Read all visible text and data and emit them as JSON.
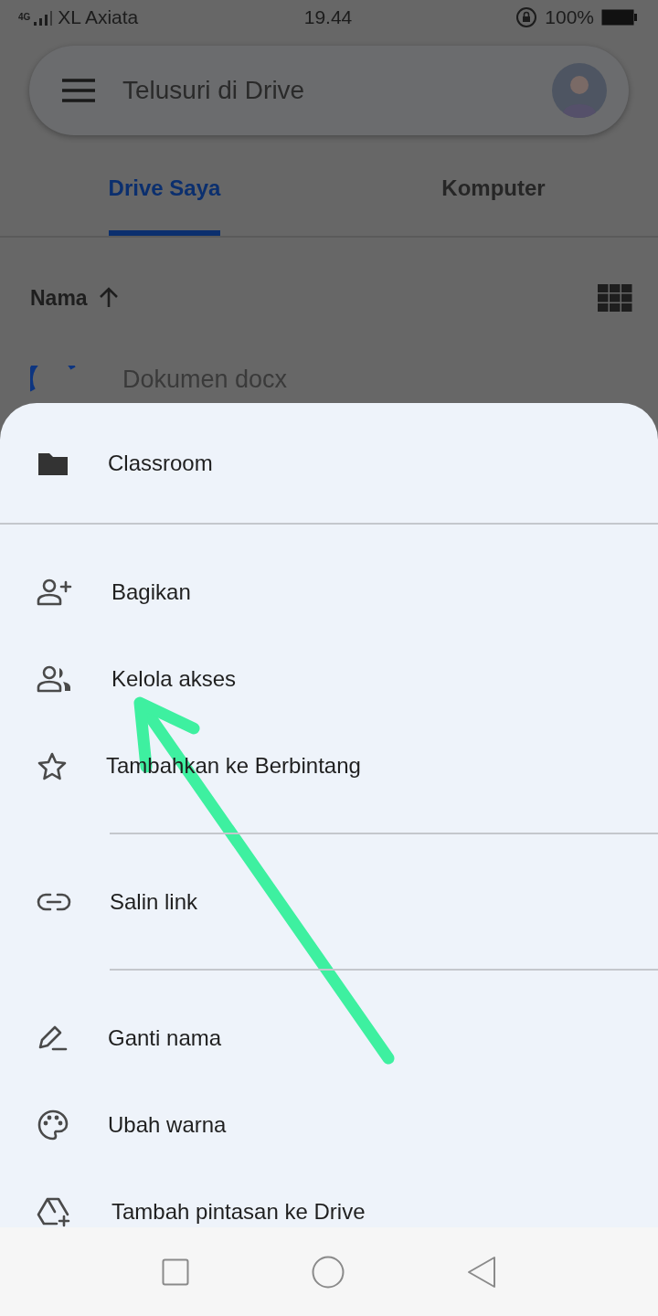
{
  "status_bar": {
    "carrier": "XL Axiata",
    "network": "4G",
    "time": "19.44",
    "battery": "100%"
  },
  "search": {
    "placeholder": "Telusuri di Drive"
  },
  "tabs": [
    {
      "label": "Drive Saya",
      "selected": true
    },
    {
      "label": "Komputer",
      "selected": false
    }
  ],
  "sort": {
    "label": "Nama"
  },
  "files": [
    {
      "name": "Dokumen docx"
    }
  ],
  "sheet": {
    "sections": [
      {
        "kind": "header",
        "items": [
          {
            "label": "Classroom"
          }
        ]
      },
      {
        "kind": "actions",
        "items": [
          {
            "label": "Bagikan"
          },
          {
            "label": "Kelola akses"
          },
          {
            "label": "Tambahkan ke Berbintang"
          }
        ]
      },
      {
        "kind": "actions",
        "items": [
          {
            "label": "Salin link"
          }
        ]
      },
      {
        "kind": "actions",
        "items": [
          {
            "label": "Ganti nama"
          },
          {
            "label": "Ubah warna"
          },
          {
            "label": "Tambah pintasan ke Drive"
          }
        ]
      }
    ]
  }
}
